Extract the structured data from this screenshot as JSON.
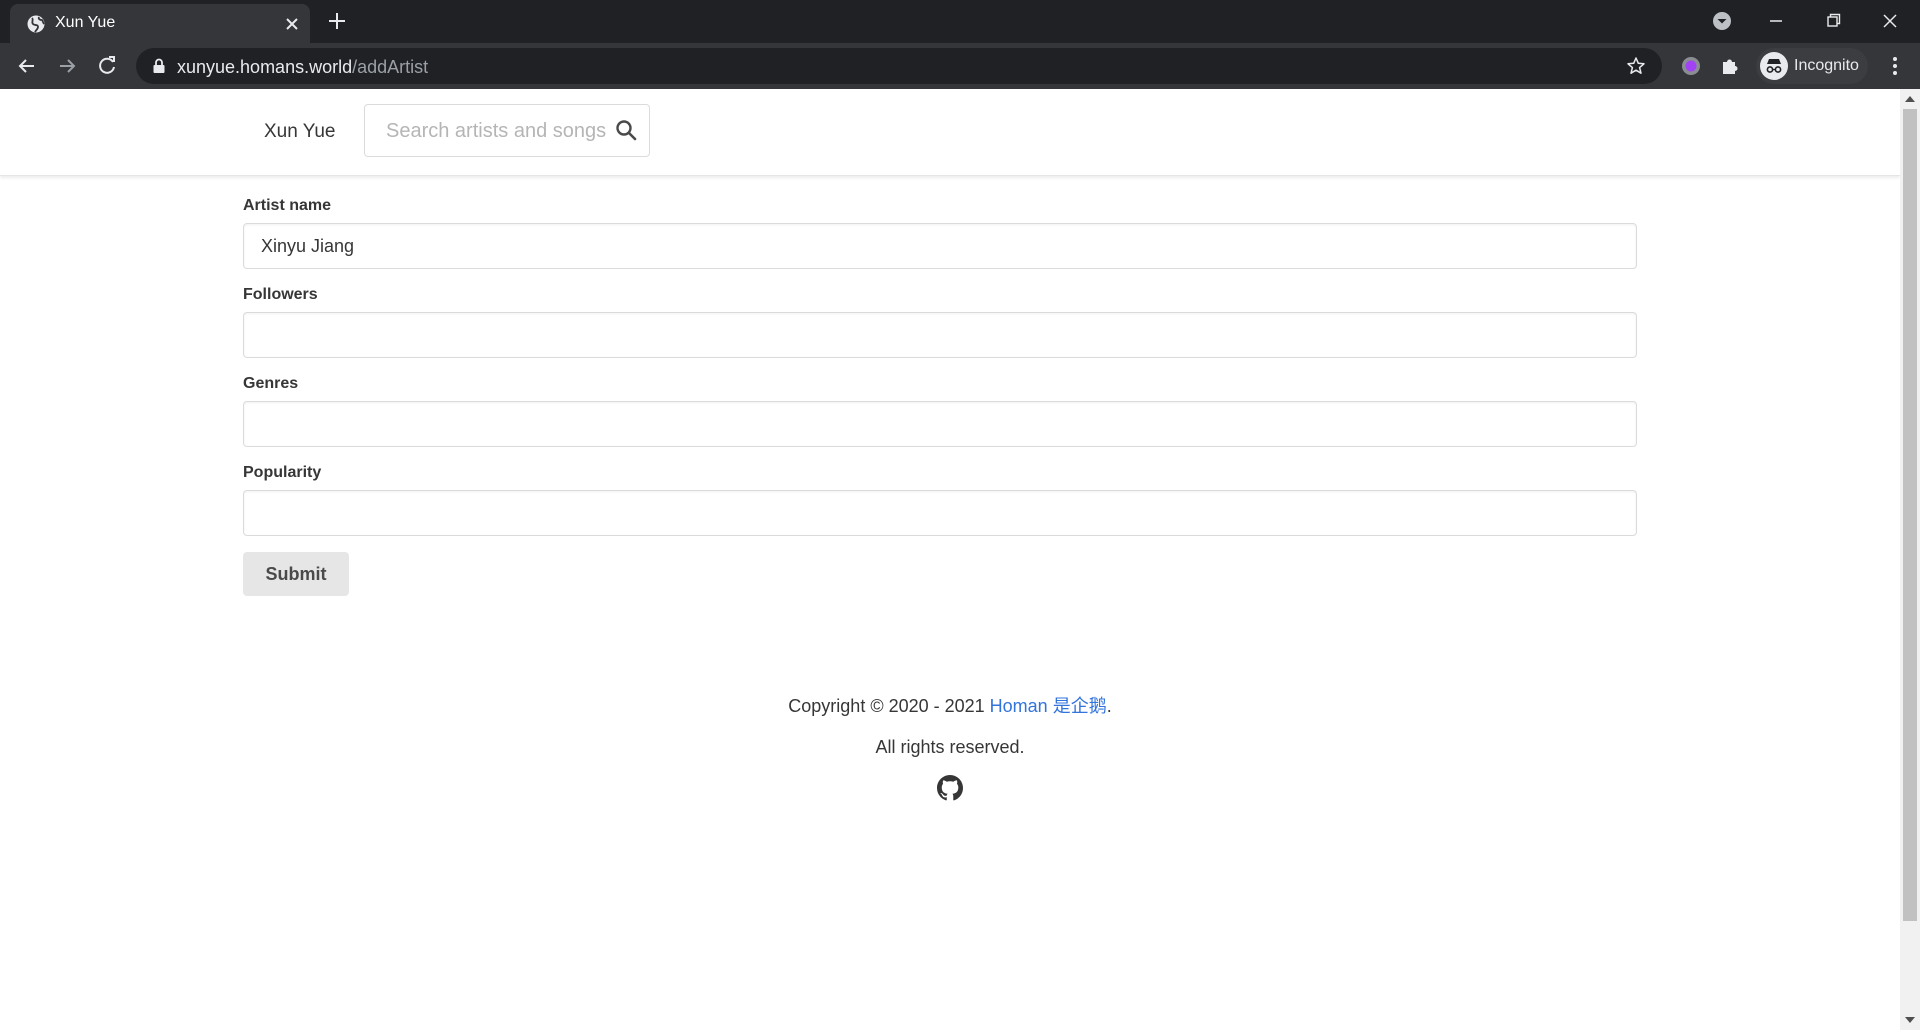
{
  "browser": {
    "tab": {
      "title": "Xun Yue"
    },
    "url": {
      "host": "xunyue.homans.world",
      "path": "/addArtist"
    },
    "profile_label": "Incognito"
  },
  "navbar": {
    "brand": "Xun Yue",
    "search": {
      "placeholder": "Search artists and songs"
    }
  },
  "form": {
    "fields": [
      {
        "label": "Artist name",
        "value": "Xinyu Jiang"
      },
      {
        "label": "Followers",
        "value": ""
      },
      {
        "label": "Genres",
        "value": ""
      },
      {
        "label": "Popularity",
        "value": ""
      }
    ],
    "submit_label": "Submit"
  },
  "footer": {
    "copyright_prefix": "Copyright © 2020 - 2021 ",
    "author_link": "Homan 是企鹅",
    "copyright_suffix": ".",
    "rights": "All rights reserved."
  },
  "colors": {
    "link": "#3273dc",
    "chrome_bg": "#202124",
    "chrome_toolbar": "#35363a",
    "button_bg": "#e6e6e6"
  },
  "icons": [
    "globe-icon",
    "close-icon",
    "plus-icon",
    "minimize-icon",
    "restore-icon",
    "window-close-icon",
    "tab-search-icon",
    "back-icon",
    "forward-icon",
    "reload-icon",
    "lock-icon",
    "star-icon",
    "extension-icon",
    "puzzle-icon",
    "incognito-icon",
    "kebab-menu-icon",
    "search-icon",
    "github-icon"
  ]
}
